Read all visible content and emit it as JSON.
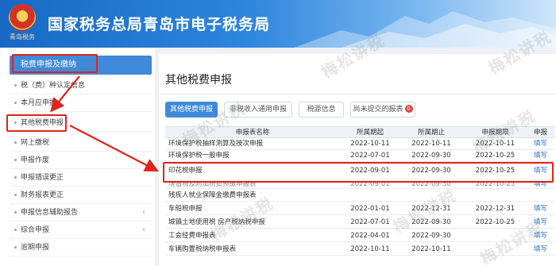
{
  "header": {
    "emblem_text": "青岛税务",
    "title": "国家税务总局青岛市电子税务局"
  },
  "sidebar": {
    "section_title": "税费申报及缴纳",
    "items": [
      {
        "label": "税（费）种认定信息",
        "chevron": ""
      },
      {
        "label": "本月应申报",
        "chevron": ""
      },
      {
        "label": "其他税费申报",
        "chevron": ""
      },
      {
        "label": "网上缴税",
        "chevron": ""
      },
      {
        "label": "申报作废",
        "chevron": ""
      },
      {
        "label": "申报错误更正",
        "chevron": ""
      },
      {
        "label": "财务报表更正",
        "chevron": ""
      },
      {
        "label": "申报信息辅助报告",
        "chevron": "‹"
      },
      {
        "label": "综合申报",
        "chevron": "‹"
      },
      {
        "label": "逾期申报",
        "chevron": ""
      }
    ]
  },
  "main": {
    "title": "其他税费申报",
    "tabs": [
      {
        "label": "其他税费申报",
        "active": true
      },
      {
        "label": "非税收入通用申报",
        "active": false
      },
      {
        "label": "税源信息",
        "active": false
      },
      {
        "label": "尚未提交的报表",
        "active": false,
        "badge": "0"
      }
    ],
    "table": {
      "headers": [
        "申报表名称",
        "所属期起",
        "所属期止",
        "申报期限",
        "申报"
      ],
      "rows": [
        {
          "name": "环境保护税抽样测算及按次申报",
          "start": "2022-10-11",
          "end": "2022-10-11",
          "due": "2022-10-11",
          "action": "填写"
        },
        {
          "name": "环境保护税一般申报",
          "start": "2022-07-01",
          "end": "2022-09-30",
          "due": "2022-10-25",
          "action": "填写"
        },
        {
          "name": "印花税申报",
          "start": "2022-09-01",
          "end": "2022-09-30",
          "due": "2022-10-25",
          "action": "填写"
        },
        {
          "name": "增值税及附加税费预缴申报表",
          "start": "2022-09-01",
          "end": "2022-09-30",
          "due": "2022-10-25",
          "action": "填写"
        },
        {
          "name": "残疾人就业保障金缴费申报表",
          "start": "",
          "end": "",
          "due": "",
          "action": ""
        },
        {
          "name": "车船税申报",
          "start": "2022-01-01",
          "end": "2022-12-31",
          "due": "2022-12-31",
          "action": "填写"
        },
        {
          "name": "城镇土地使用税 房产税纳税申报",
          "start": "2022-07-01",
          "end": "2022-09-30",
          "due": "2022-10-25",
          "action": "填写"
        },
        {
          "name": "工会经费申报表",
          "start": "2022-04-01",
          "end": "2022-09-30",
          "due": "",
          "action": "填写"
        },
        {
          "name": "车辆购置税纳税申报表",
          "start": "2022-10-11",
          "end": "2022-10-11",
          "due": "",
          "action": "填写"
        }
      ]
    }
  },
  "watermark_text": "梅松讲税",
  "colors": {
    "accent": "#3e8ad8",
    "highlight": "#e0231c",
    "link": "#2a72c9"
  }
}
